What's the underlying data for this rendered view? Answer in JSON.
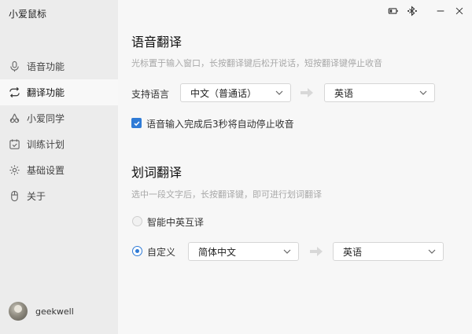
{
  "app": {
    "title": "小爱鼠标"
  },
  "sidebar": {
    "items": [
      {
        "label": "语音功能",
        "icon": "microphone-icon",
        "active": false
      },
      {
        "label": "翻译功能",
        "icon": "translate-loop-icon",
        "active": true
      },
      {
        "label": "小爱同学",
        "icon": "xiaoai-icon",
        "active": false
      },
      {
        "label": "训练计划",
        "icon": "calendar-check-icon",
        "active": false
      },
      {
        "label": "基础设置",
        "icon": "gear-icon",
        "active": false
      },
      {
        "label": "关于",
        "icon": "mouse-icon",
        "active": false
      }
    ],
    "user": {
      "name": "geekwell"
    }
  },
  "voice_translate": {
    "title": "语音翻译",
    "desc": "光标置于输入窗口，长按翻译键后松开说话，短按翻译键停止收音",
    "lang_label": "支持语言",
    "source_lang": "中文（普通话）",
    "target_lang": "英语",
    "auto_stop_label": "语音输入完成后3秒将自动停止收音",
    "auto_stop_checked": true
  },
  "word_translate": {
    "title": "划词翻译",
    "desc": "选中一段文字后，长按翻译键，即可进行划词翻译",
    "smart_label": "智能中英互译",
    "custom_label": "自定义",
    "source_lang": "简体中文",
    "target_lang": "英语",
    "selected_mode": "custom"
  },
  "colors": {
    "accent": "#2f7bd6",
    "sidebar_bg": "#ececec",
    "main_bg": "#f7f7f7"
  }
}
